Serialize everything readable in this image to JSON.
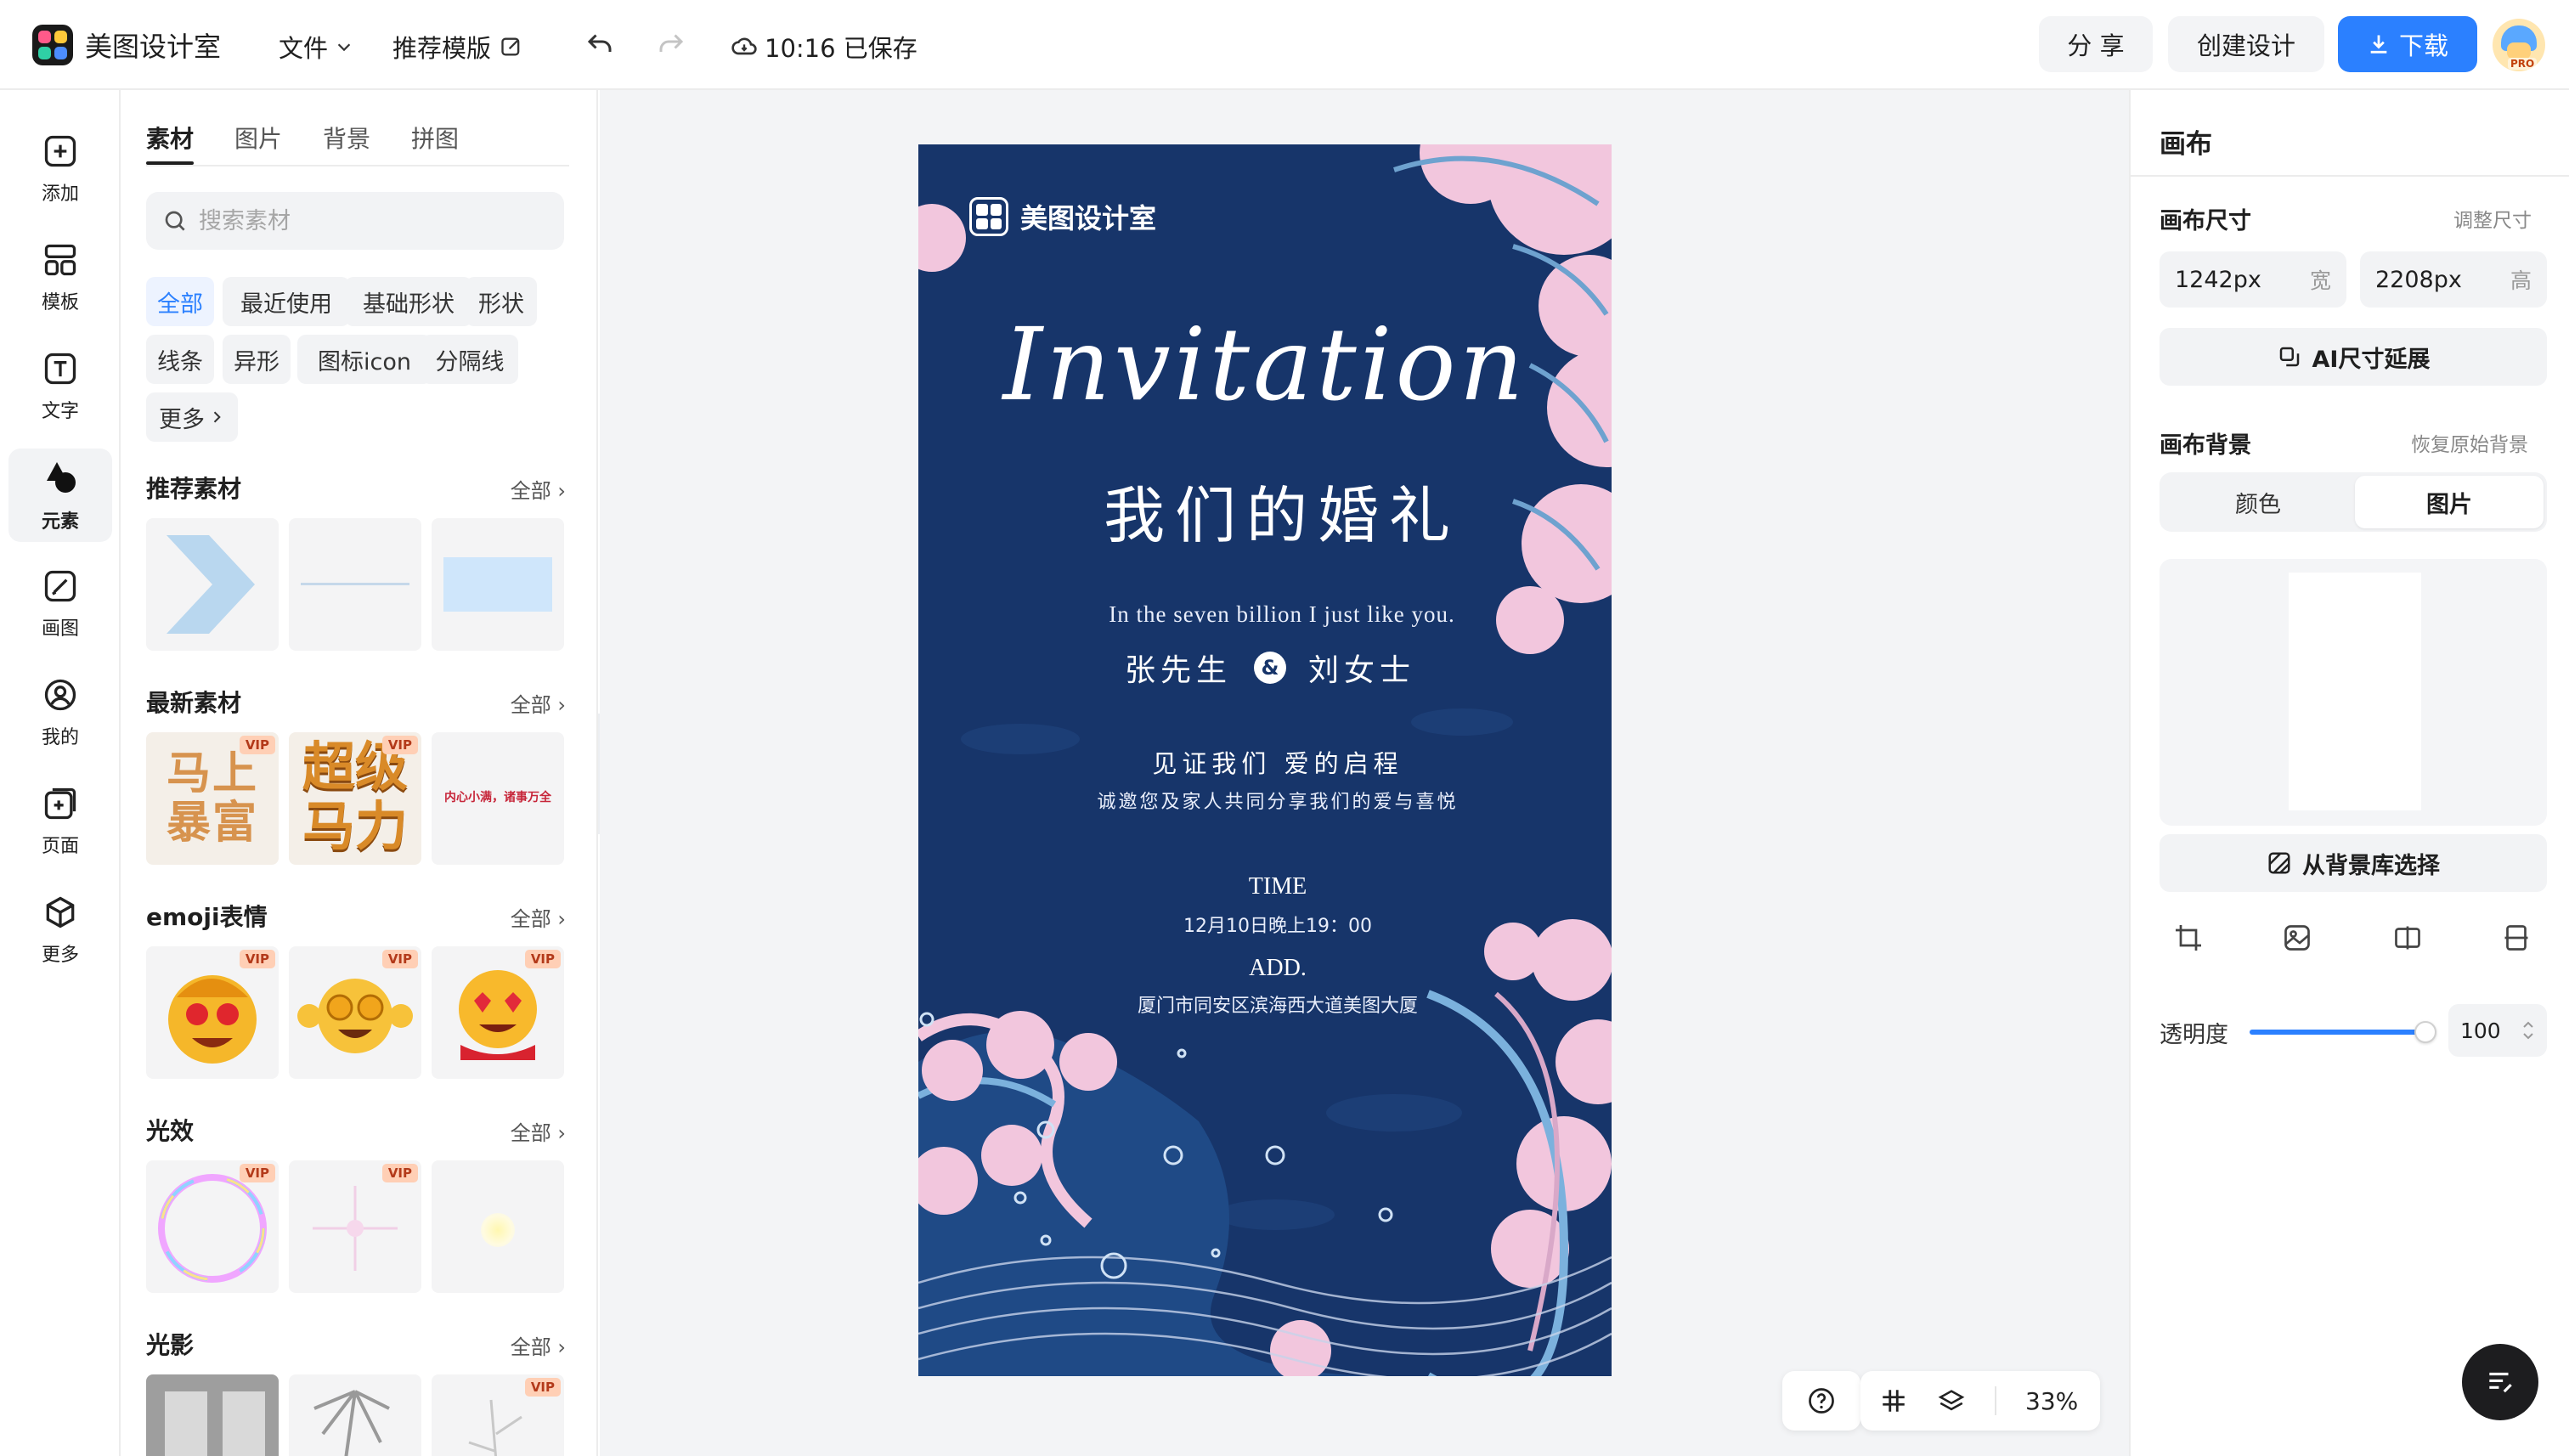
{
  "header": {
    "app_name": "美图设计室",
    "menu_file": "文件",
    "menu_template": "推荐模版",
    "save_status": "10:16 已保存",
    "share": "分 享",
    "create": "创建设计",
    "download": "下载",
    "avatar_badge": "PRO"
  },
  "leftnav": [
    {
      "label": "添加",
      "icon": "plus-square-icon"
    },
    {
      "label": "模板",
      "icon": "template-icon"
    },
    {
      "label": "文字",
      "icon": "text-icon"
    },
    {
      "label": "元素",
      "icon": "shapes-icon"
    },
    {
      "label": "画图",
      "icon": "brush-icon"
    },
    {
      "label": "我的",
      "icon": "user-icon"
    },
    {
      "label": "页面",
      "icon": "page-add-icon"
    },
    {
      "label": "更多",
      "icon": "cube-icon"
    }
  ],
  "panel": {
    "tabs": [
      "素材",
      "图片",
      "背景",
      "拼图"
    ],
    "search_placeholder": "搜索素材",
    "chips": [
      "全部",
      "最近使用",
      "基础形状",
      "形状",
      "线条",
      "异形",
      "图标icon",
      "分隔线",
      "更多"
    ],
    "more_label": "全部",
    "vip": "VIP",
    "sections": [
      {
        "title": "推荐素材"
      },
      {
        "title": "最新素材"
      },
      {
        "title": "emoji表情"
      },
      {
        "title": "光效"
      },
      {
        "title": "光影"
      }
    ],
    "newest_thumbs": [
      "马上暴富",
      "超级马力",
      "内心小满，诸事万全"
    ]
  },
  "poster": {
    "brand": "美图设计室",
    "script_title": "Invitation",
    "headline": "我们的婚礼",
    "tagline": "In the seven billion I just like you.",
    "groom": "张先生",
    "amp": "&",
    "bride": "刘女士",
    "witness": "见证我们 爱的启程",
    "invite": "诚邀您及家人共同分享我们的爱与喜悦",
    "time_label": "TIME",
    "time_value": "12月10日晚上19：00",
    "add_label": "ADD.",
    "add_value": "厦门市同安区滨海西大道美图大厦"
  },
  "bottombar": {
    "zoom": "33%"
  },
  "right": {
    "title": "画布",
    "size_label": "画布尺寸",
    "resize_link": "调整尺寸",
    "width_value": "1242px",
    "width_unit": "宽",
    "height_value": "2208px",
    "height_unit": "高",
    "ai_extend": "AI尺寸延展",
    "bg_label": "画布背景",
    "restore_link": "恢复原始背景",
    "seg_color": "颜色",
    "seg_image": "图片",
    "from_library": "从背景库选择",
    "opacity_label": "透明度",
    "opacity_value": "100"
  },
  "colors": {
    "accent": "#2b80ff",
    "poster_bg": "#17356a",
    "wave_pink": "#f2c6dd",
    "wave_blue": "#2d6ea5"
  }
}
